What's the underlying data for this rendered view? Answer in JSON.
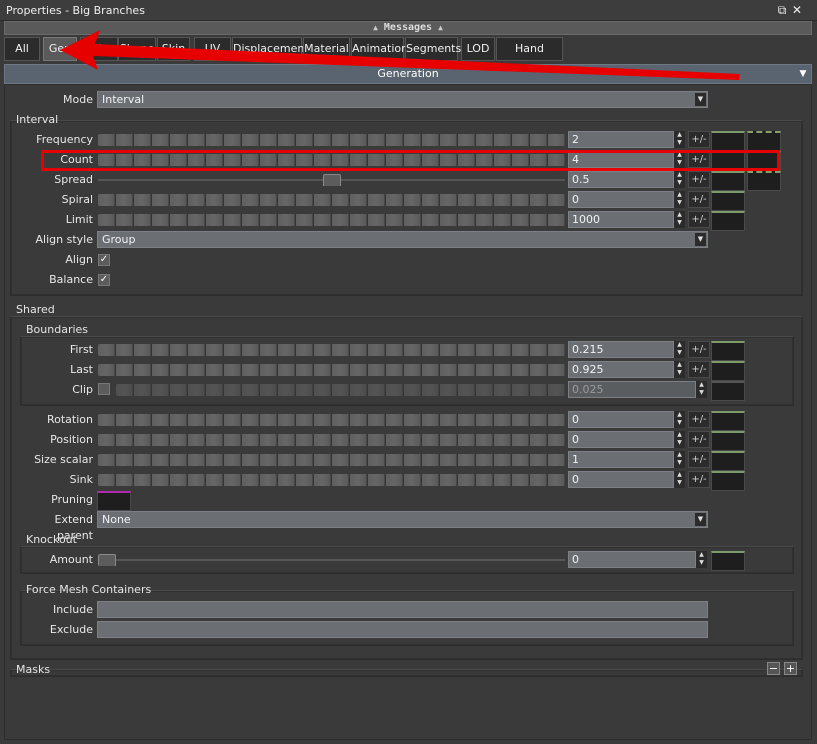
{
  "window": {
    "title": "Properties - Big Branches",
    "float_icon": "⧉",
    "close_icon": "✕"
  },
  "messages": {
    "label": "Messages"
  },
  "tabs": [
    "All",
    "Gen",
    "Shape",
    "Skin",
    "UV",
    "Displacement",
    "Material",
    "Animation",
    "Segments",
    "LOD",
    "Hand Drawn"
  ],
  "tab_hidden_label": "Ph",
  "section": {
    "title": "Generation"
  },
  "mode": {
    "label": "Mode",
    "value": "Interval"
  },
  "interval": {
    "title": "Interval",
    "frequency": {
      "label": "Frequency",
      "value": "2"
    },
    "count": {
      "label": "Count",
      "value": "4"
    },
    "spread": {
      "label": "Spread",
      "value": "0.5",
      "level": 0.5
    },
    "spiral": {
      "label": "Spiral",
      "value": "0"
    },
    "limit": {
      "label": "Limit",
      "value": "1000"
    },
    "align_style": {
      "label": "Align style",
      "value": "Group"
    },
    "align": {
      "label": "Align",
      "checked": true
    },
    "balance": {
      "label": "Balance",
      "checked": true
    }
  },
  "shared": {
    "title": "Shared",
    "boundaries": {
      "title": "Boundaries",
      "first": {
        "label": "First",
        "value": "0.215"
      },
      "last": {
        "label": "Last",
        "value": "0.925"
      },
      "clip": {
        "label": "Clip",
        "value": "0.025",
        "checked": false
      }
    },
    "rotation": {
      "label": "Rotation",
      "value": "0"
    },
    "position": {
      "label": "Position",
      "value": "0"
    },
    "size_scalar": {
      "label": "Size scalar",
      "value": "1"
    },
    "sink": {
      "label": "Sink",
      "value": "0"
    },
    "pruning": {
      "label": "Pruning"
    },
    "extend_parent": {
      "label": "Extend parent",
      "value": "None"
    },
    "knockout": {
      "title": "Knockout",
      "amount": {
        "label": "Amount",
        "value": "0",
        "level": 0
      }
    },
    "force_mesh": {
      "title": "Force Mesh Containers",
      "include": {
        "label": "Include",
        "value": ""
      },
      "exclude": {
        "label": "Exclude",
        "value": ""
      }
    }
  },
  "masks": {
    "title": "Masks",
    "minus": "−",
    "plus": "+"
  },
  "plusminus": "+/-",
  "colors": {
    "highlight": "#e60000",
    "header": "#5a6470"
  }
}
